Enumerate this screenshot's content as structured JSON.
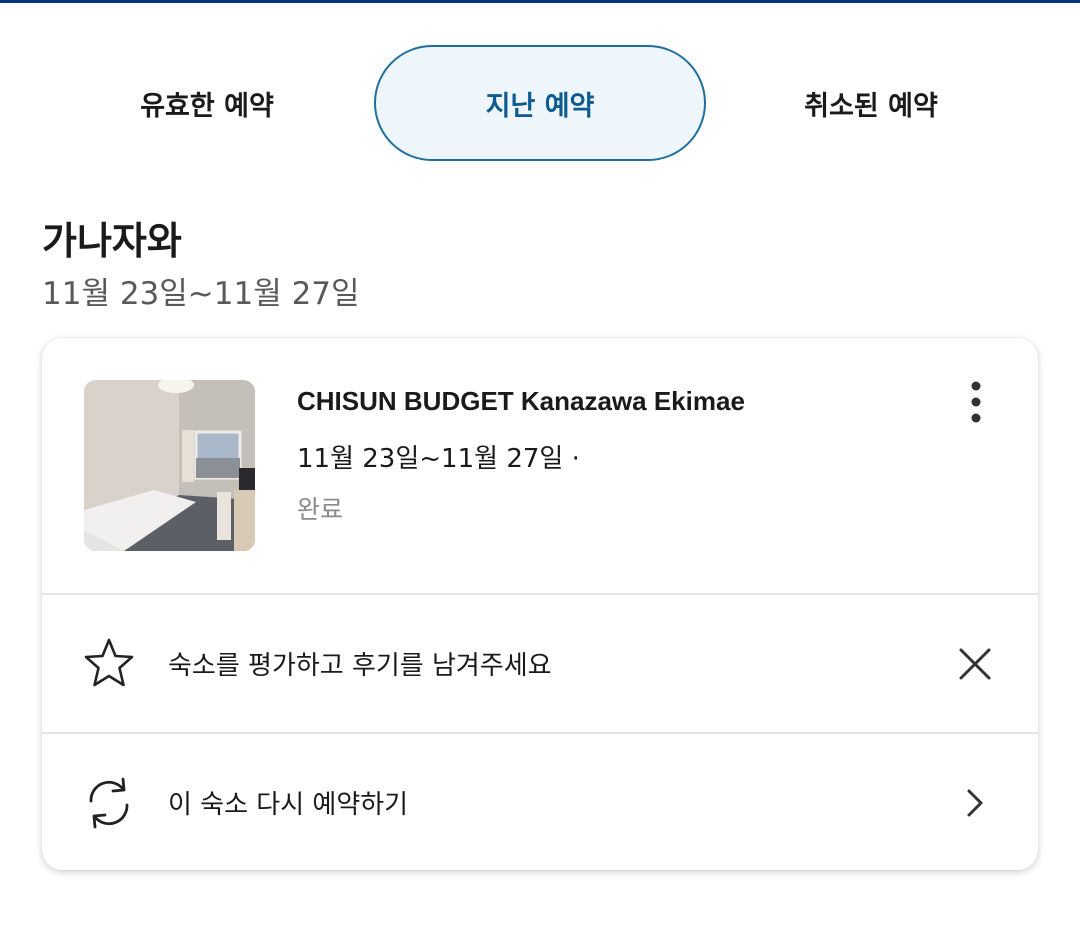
{
  "tabs": [
    {
      "label": "유효한 예약",
      "active": false
    },
    {
      "label": "지난 예약",
      "active": true
    },
    {
      "label": "취소된 예약",
      "active": false
    }
  ],
  "destination": {
    "title": "가나자와",
    "dates": "11월 23일~11월 27일"
  },
  "booking": {
    "hotel_name": "CHISUN BUDGET Kanazawa Ekimae",
    "dates": "11월 23일~11월 27일 ·",
    "status": "완료",
    "more_icon": "more-vertical-icon",
    "thumbnail_icon": "hotel-room-photo"
  },
  "actions": [
    {
      "label": "숙소를 평가하고 후기를 남겨주세요",
      "icon": "star-icon",
      "action_icon": "close-icon"
    },
    {
      "label": "이 숙소 다시 예약하기",
      "icon": "refresh-icon",
      "action_icon": "chevron-right-icon"
    }
  ],
  "colors": {
    "accent": "#0d5c91",
    "active_tab_bg": "#eef6fc",
    "top_bar": "#003580",
    "muted_text": "#8a8a8a"
  }
}
